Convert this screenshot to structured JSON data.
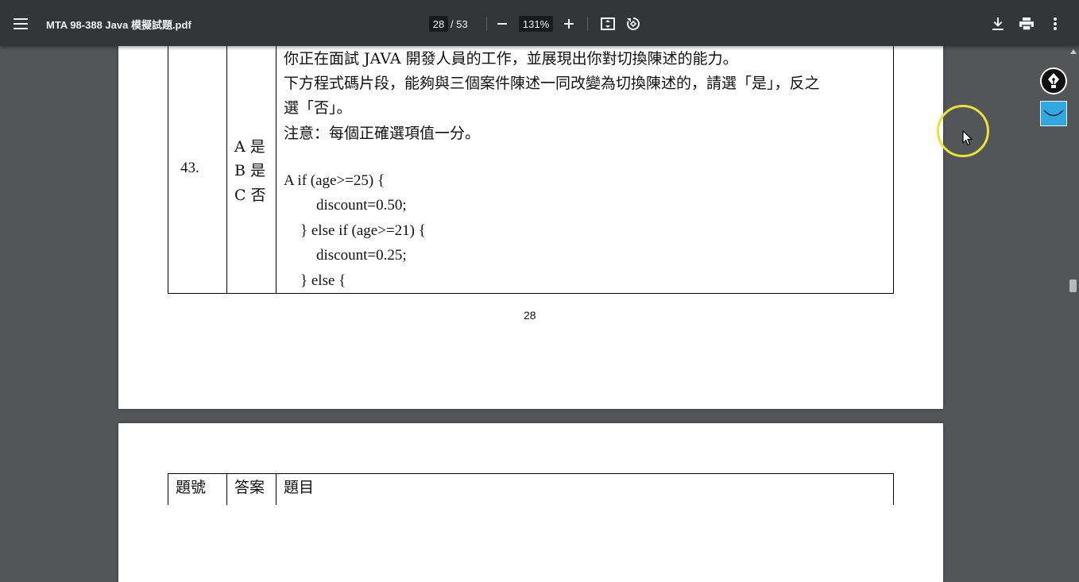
{
  "toolbar": {
    "menu_icon": "hamburger-menu-icon",
    "title": "MTA 98-388 Java 模擬試題.pdf",
    "current_page": "28",
    "page_total": "/ 53",
    "zoom_value": "131%",
    "zoom_out_icon": "minus-icon",
    "zoom_in_icon": "plus-icon",
    "fit_icon": "fit-to-page-icon",
    "rotate_icon": "rotate-icon",
    "download_icon": "download-icon",
    "print_icon": "print-icon",
    "more_icon": "more-vert-icon"
  },
  "page1": {
    "question_number": "43.",
    "answers": [
      "A 是",
      "B 是",
      "C 否"
    ],
    "question_lines": [
      "你正在面試 JAVA 開發人員的工作，並展現出你對切換陳述的能力。",
      "下方程式碼片段，能夠與三個案件陳述一同改變為切換陳述的，請選「是」，反之",
      "選「否」。",
      "注意：每個正確選項值一分。"
    ],
    "code_lines": [
      "A if (age>=25) {",
      "discount=0.50;",
      "} else if (age>=21) {",
      "discount=0.25;",
      "} else {"
    ],
    "page_number": "28"
  },
  "page2": {
    "headers": [
      "題號",
      "答案",
      "題目"
    ]
  },
  "extensions": {
    "pen_icon": "fountain-pen-icon",
    "smile_icon": "smile-icon"
  },
  "colors": {
    "toolbar_bg": "#323639",
    "viewer_bg": "#525659",
    "cursor_highlight": "#ece233",
    "extension_blue": "#2fa9e0"
  }
}
